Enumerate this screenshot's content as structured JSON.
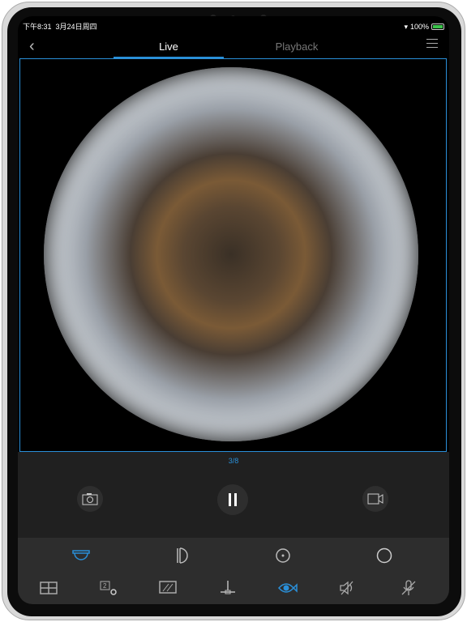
{
  "status_bar": {
    "time": "下午8:31",
    "date": "3月24日周四",
    "battery": "100%"
  },
  "header": {
    "tabs": [
      {
        "label": "Live",
        "active": true
      },
      {
        "label": "Playback",
        "active": false
      }
    ]
  },
  "video": {
    "channel_counter": "3/8"
  },
  "controls": [
    "camera-icon",
    "pause-icon",
    "video-record-icon"
  ],
  "toolbar_row1": [
    "ceiling-mount-icon",
    "wall-mount-icon",
    "rotate-icon",
    "circle-view-icon"
  ],
  "toolbar_row2": [
    "grid-layout-icon",
    "stream-select-icon",
    "image-quality-icon",
    "ptz-joystick-icon",
    "fisheye-icon",
    "speaker-muted-icon",
    "mic-muted-icon"
  ],
  "colors": {
    "accent": "#2a8fd8",
    "toolbar_bg": "#2d2d2d",
    "icon": "#bbbbbb"
  }
}
